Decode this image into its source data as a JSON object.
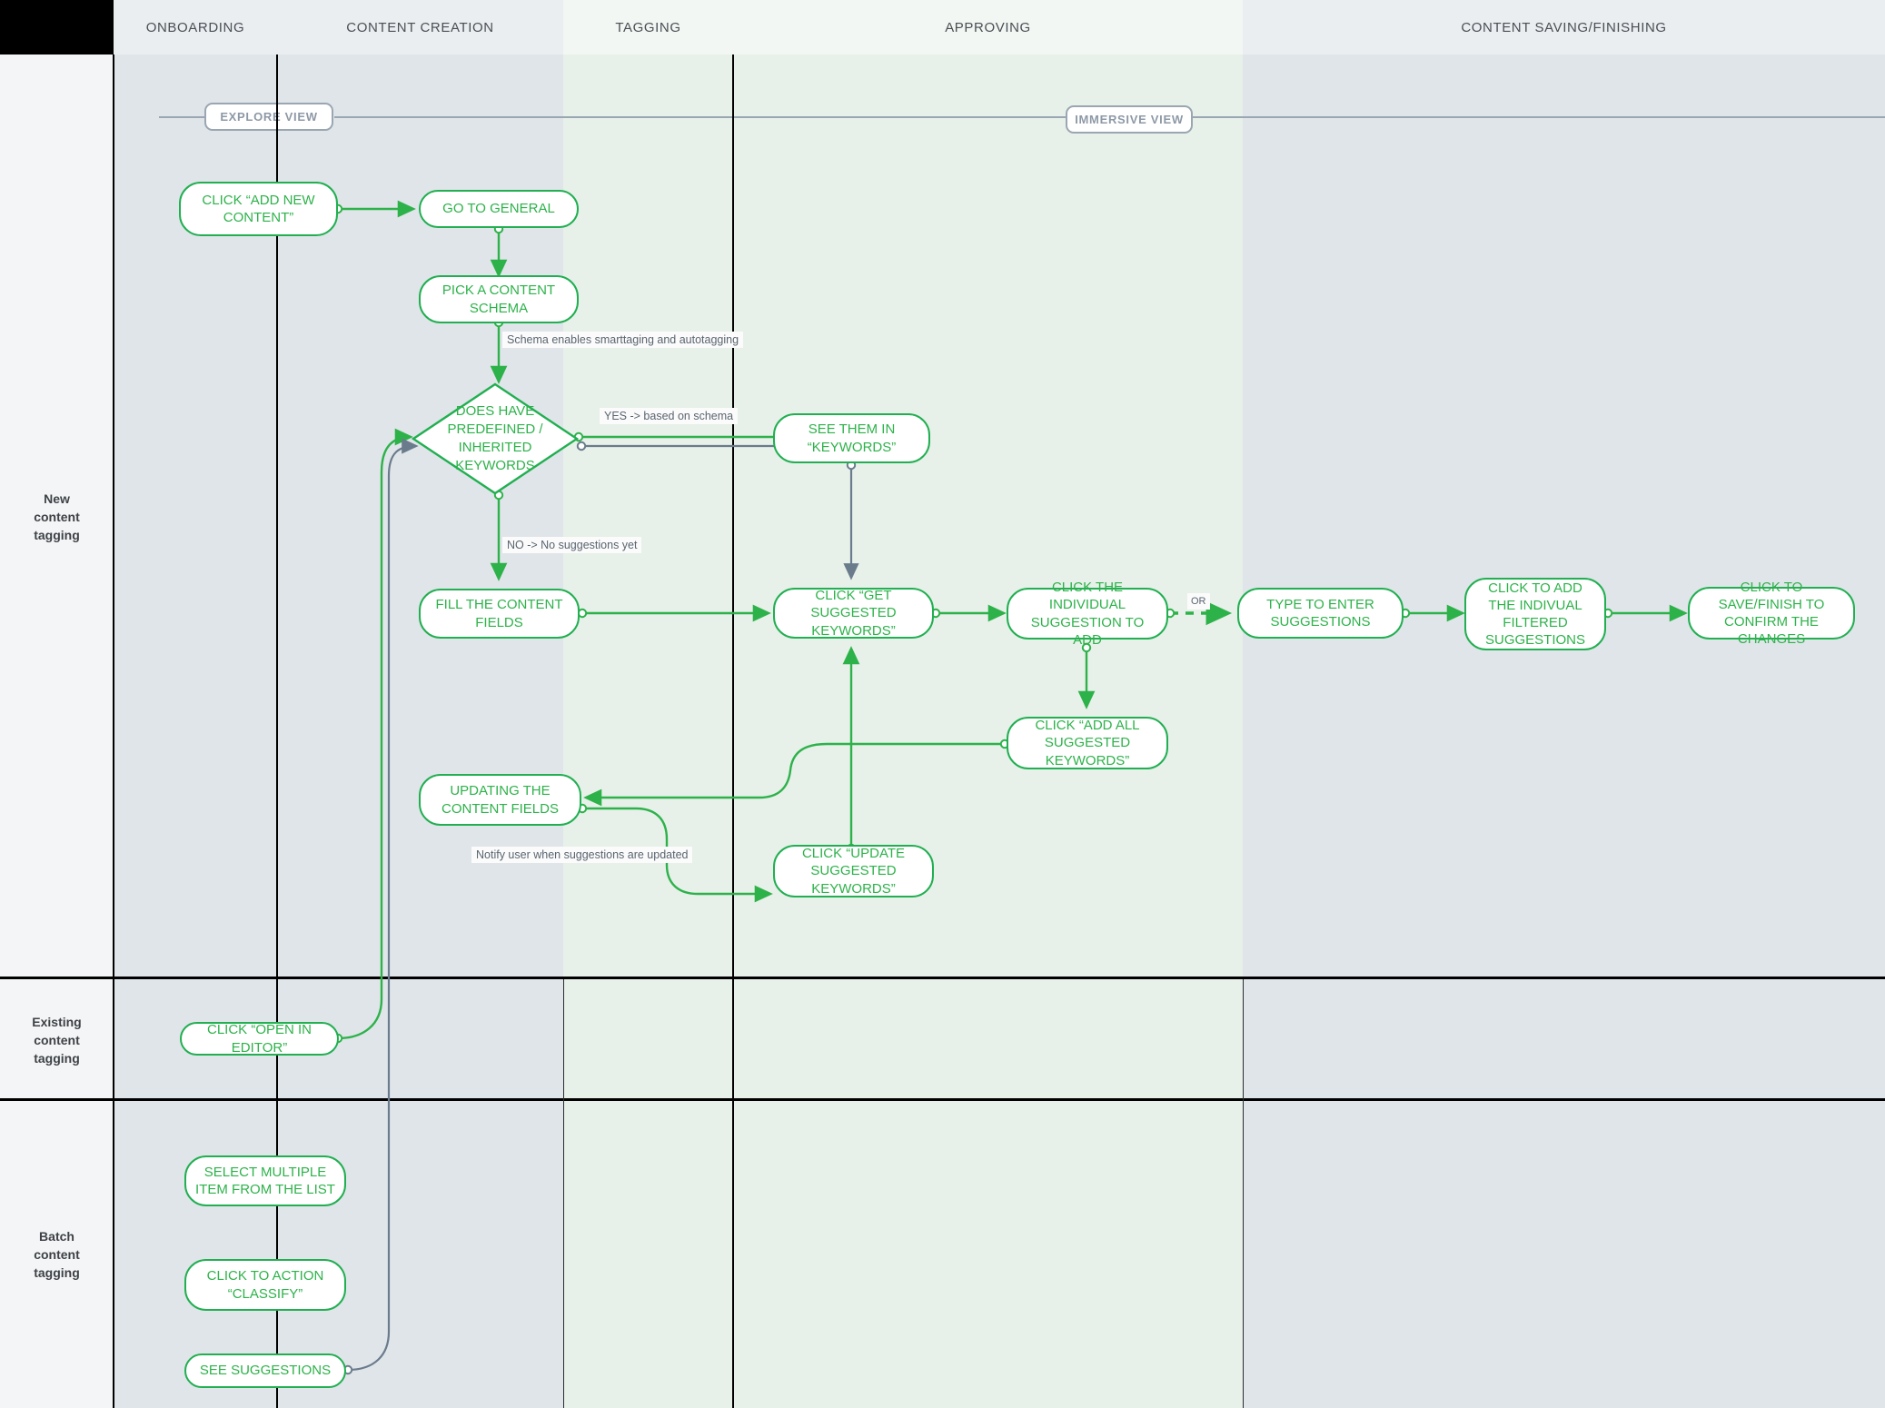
{
  "columns": [
    {
      "key": "onboarding",
      "label": "ONBOARDING"
    },
    {
      "key": "content_creation",
      "label": "CONTENT CREATION"
    },
    {
      "key": "tagging",
      "label": "TAGGING"
    },
    {
      "key": "approving",
      "label": "APPROVING"
    },
    {
      "key": "content_saving",
      "label": "CONTENT SAVING/FINISHING"
    }
  ],
  "lanes": [
    {
      "key": "new",
      "label": "New\ncontent\ntagging"
    },
    {
      "key": "existing",
      "label": "Existing\ncontent\ntagging"
    },
    {
      "key": "batch",
      "label": "Batch\ncontent\ntagging"
    }
  ],
  "view_pills": [
    {
      "key": "explore",
      "label": "EXPLORE VIEW"
    },
    {
      "key": "immersive",
      "label": "IMMERSIVE VIEW"
    }
  ],
  "nodes": {
    "add_new_content": "CLICK “ADD NEW CONTENT”",
    "go_to_general": "GO TO GENERAL",
    "pick_schema": "PICK A CONTENT SCHEMA",
    "decision_keywords": "DOES HAVE PREDEFINED / INHERITED KEYWORDS",
    "see_them_in_keywords": "SEE THEM IN “KEYWORDS”",
    "fill_content_fields": "FILL THE CONTENT FIELDS",
    "get_suggested_keywords": "CLICK “GET SUGGESTED KEYWORDS”",
    "click_individual_suggestion": "CLICK THE INDIVIDUAL SUGGESTION TO ADD",
    "type_to_enter": "TYPE TO ENTER SUGGESTIONS",
    "add_individual_filtered": "CLICK TO ADD THE INDIVUAL FILTERED SUGGESTIONS",
    "save_finish": "CLICK TO SAVE/FINISH TO CONFIRM THE CHANGES",
    "add_all_suggested": "CLICK “ADD ALL SUGGESTED KEYWORDS”",
    "updating_content_fields": "UPDATING THE CONTENT FIELDS",
    "update_suggested_keywords": "CLICK “UPDATE SUGGESTED KEYWORDS”",
    "open_in_editor": "CLICK “OPEN IN EDITOR”",
    "select_multiple_items": "SELECT MULTIPLE ITEM FROM THE LIST",
    "action_classify": "CLICK TO ACTION “CLASSIFY”",
    "see_suggestions": "SEE SUGGESTIONS"
  },
  "edge_labels": {
    "schema_enables": "Schema enables smarttaging and autotagging",
    "yes_branch": "YES -> based on schema",
    "no_branch": "NO -> No suggestions yet",
    "notify_user": "Notify user when suggestions are updated",
    "or": "OR"
  },
  "colors": {
    "node_stroke": "#21af51",
    "node_text": "#2db24a",
    "edge_green": "#2db24a",
    "edge_grey": "#6a7b8c",
    "pill_stroke": "#9aa6b2",
    "band_blue": "#e0e5e9",
    "band_green": "#e7f0e9",
    "header_blue": "#eaeef1",
    "header_green": "#f2f7f3"
  }
}
